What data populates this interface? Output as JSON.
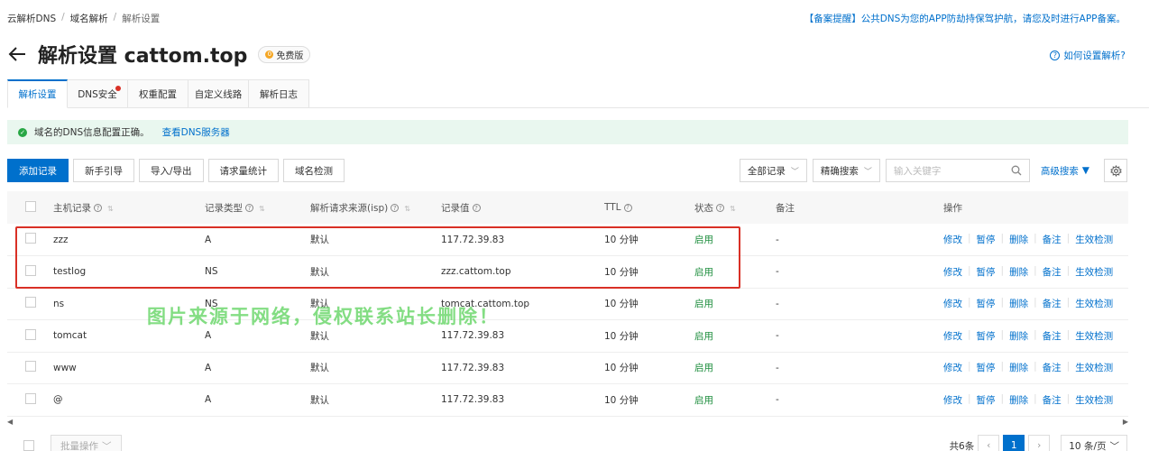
{
  "breadcrumb": [
    "云解析DNS",
    "域名解析",
    "解析设置"
  ],
  "notice": {
    "tag": "【备案提醒】",
    "text": "公共DNS为您的APP防劫持保驾护航，请您及时进行APP备案。"
  },
  "title": "解析设置 cattom.top",
  "plan_badge": "免费版",
  "help_link": "如何设置解析?",
  "tabs": [
    {
      "label": "解析设置",
      "active": true
    },
    {
      "label": "DNS安全",
      "dot": true
    },
    {
      "label": "权重配置"
    },
    {
      "label": "自定义线路"
    },
    {
      "label": "解析日志"
    }
  ],
  "status": {
    "text": "域名的DNS信息配置正确。",
    "link": "查看DNS服务器"
  },
  "toolbar": {
    "add": "添加记录",
    "guide": "新手引导",
    "import": "导入/导出",
    "stats": "请求量统计",
    "check": "域名检测"
  },
  "filters": {
    "all_records": "全部记录",
    "exact_search": "精确搜索",
    "search_placeholder": "输入关键字",
    "advanced": "高级搜索"
  },
  "columns": {
    "host": "主机记录",
    "type": "记录类型",
    "isp": "解析请求来源(isp)",
    "value": "记录值",
    "ttl": "TTL",
    "status": "状态",
    "remark": "备注",
    "ops": "操作"
  },
  "rows": [
    {
      "host": "zzz",
      "type": "A",
      "isp": "默认",
      "value": "117.72.39.83",
      "ttl": "10 分钟",
      "status": "启用",
      "remark": "-"
    },
    {
      "host": "testlog",
      "type": "NS",
      "isp": "默认",
      "value": "zzz.cattom.top",
      "ttl": "10 分钟",
      "status": "启用",
      "remark": "-"
    },
    {
      "host": "ns",
      "type": "NS",
      "isp": "默认",
      "value": "tomcat.cattom.top",
      "ttl": "10 分钟",
      "status": "启用",
      "remark": "-"
    },
    {
      "host": "tomcat",
      "type": "A",
      "isp": "默认",
      "value": "117.72.39.83",
      "ttl": "10 分钟",
      "status": "启用",
      "remark": "-"
    },
    {
      "host": "www",
      "type": "A",
      "isp": "默认",
      "value": "117.72.39.83",
      "ttl": "10 分钟",
      "status": "启用",
      "remark": "-"
    },
    {
      "host": "@",
      "type": "A",
      "isp": "默认",
      "value": "117.72.39.83",
      "ttl": "10 分钟",
      "status": "启用",
      "remark": "-"
    }
  ],
  "ops": [
    "修改",
    "暂停",
    "删除",
    "备注",
    "生效检测"
  ],
  "watermark": "图片来源于网络，侵权联系站长删除！",
  "footer": {
    "batch": "批量操作",
    "total": "共6条",
    "page": "1",
    "page_size": "10 条/页"
  },
  "colors": {
    "accent": "#0070cc",
    "success": "#1e8e3e",
    "highlight": "#d93026"
  }
}
